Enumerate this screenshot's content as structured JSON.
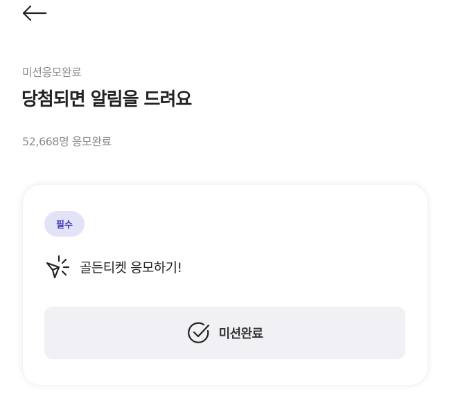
{
  "header": {
    "back_icon": "arrow-left-icon"
  },
  "intro": {
    "eyebrow": "미션응모완료",
    "title": "당첨되면 알림을 드려요",
    "count": "52,668명 응모완료"
  },
  "mission_card": {
    "badge": "필수",
    "mission_icon": "paper-plane-sparkle-icon",
    "mission_label": "골든티켓 응모하기!",
    "complete_icon": "check-circle-icon",
    "complete_label": "미션완료"
  },
  "colors": {
    "badge_background": "#e3e3f8",
    "badge_text": "#3d35b8",
    "button_background": "#f0f0f5",
    "title_text": "#222222",
    "muted_text": "#8c8c8c"
  }
}
